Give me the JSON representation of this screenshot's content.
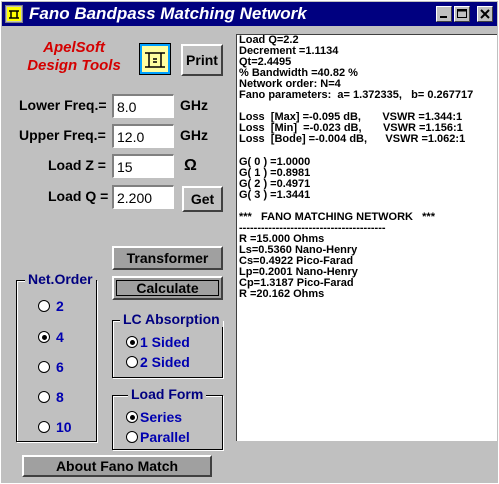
{
  "window": {
    "title": "Fano Bandpass Matching Network"
  },
  "brand": {
    "line1": "ApelSoft",
    "line2": "Design Tools"
  },
  "buttons": {
    "print": "Print",
    "get": "Get",
    "transformer": "Transformer",
    "calculate": "Calculate",
    "about": "About Fano Match"
  },
  "fields": {
    "lower_freq": {
      "label": "Lower Freq.=",
      "value": "8.0",
      "unit": "GHz"
    },
    "upper_freq": {
      "label": "Upper Freq.=",
      "value": "12.0",
      "unit": "GHz"
    },
    "load_z": {
      "label": "Load Z =",
      "value": "15",
      "unit": "Ω"
    },
    "load_q": {
      "label": "Load Q =",
      "value": "2.200"
    }
  },
  "net_order": {
    "title": "Net.Order",
    "options": [
      {
        "label": "2",
        "selected": false
      },
      {
        "label": "4",
        "selected": true
      },
      {
        "label": "6",
        "selected": false
      },
      {
        "label": "8",
        "selected": false
      },
      {
        "label": "10",
        "selected": false
      }
    ]
  },
  "lc_absorption": {
    "title": "LC Absorption",
    "options": [
      {
        "label": "1 Sided",
        "selected": true
      },
      {
        "label": "2 Sided",
        "selected": false
      }
    ]
  },
  "load_form": {
    "title": "Load Form",
    "options": [
      {
        "label": "Series",
        "selected": true
      },
      {
        "label": "Parallel",
        "selected": false
      }
    ]
  },
  "output": {
    "lines": [
      "Load Q=2.2",
      "Decrement =1.1134",
      "Qt=2.4495",
      "% Bandwidth =40.82 %",
      "Network order: N=4",
      "Fano parameters:  a= 1.372335,   b= 0.267717",
      "",
      "Loss  [Max] =-0.095 dB,       VSWR =1.344:1",
      "Loss  [Min]  =-0.023 dB,       VSWR =1.156:1",
      "Loss  [Bode] =-0.004 dB,      VSWR =1.062:1",
      "",
      "G( 0 ) =1.0000",
      "G( 1 ) =0.8981",
      "G( 2 ) =0.4971",
      "G( 3 ) =1.3441",
      "",
      "***   FANO MATCHING NETWORK   ***",
      "----------------------------------------",
      "R =15.000 Ohms",
      "Ls=0.5360 Nano-Henry",
      "Cs=0.4922 Pico-Farad",
      "Lp=0.2001 Nano-Henry",
      "Cp=1.3187 Pico-Farad",
      "R =20.162 Ohms"
    ]
  },
  "colors": {
    "title_bar": "#000080",
    "brand_red": "#d40000",
    "radio_label_blue": "#0000b0",
    "face": "#c0c0c0"
  }
}
